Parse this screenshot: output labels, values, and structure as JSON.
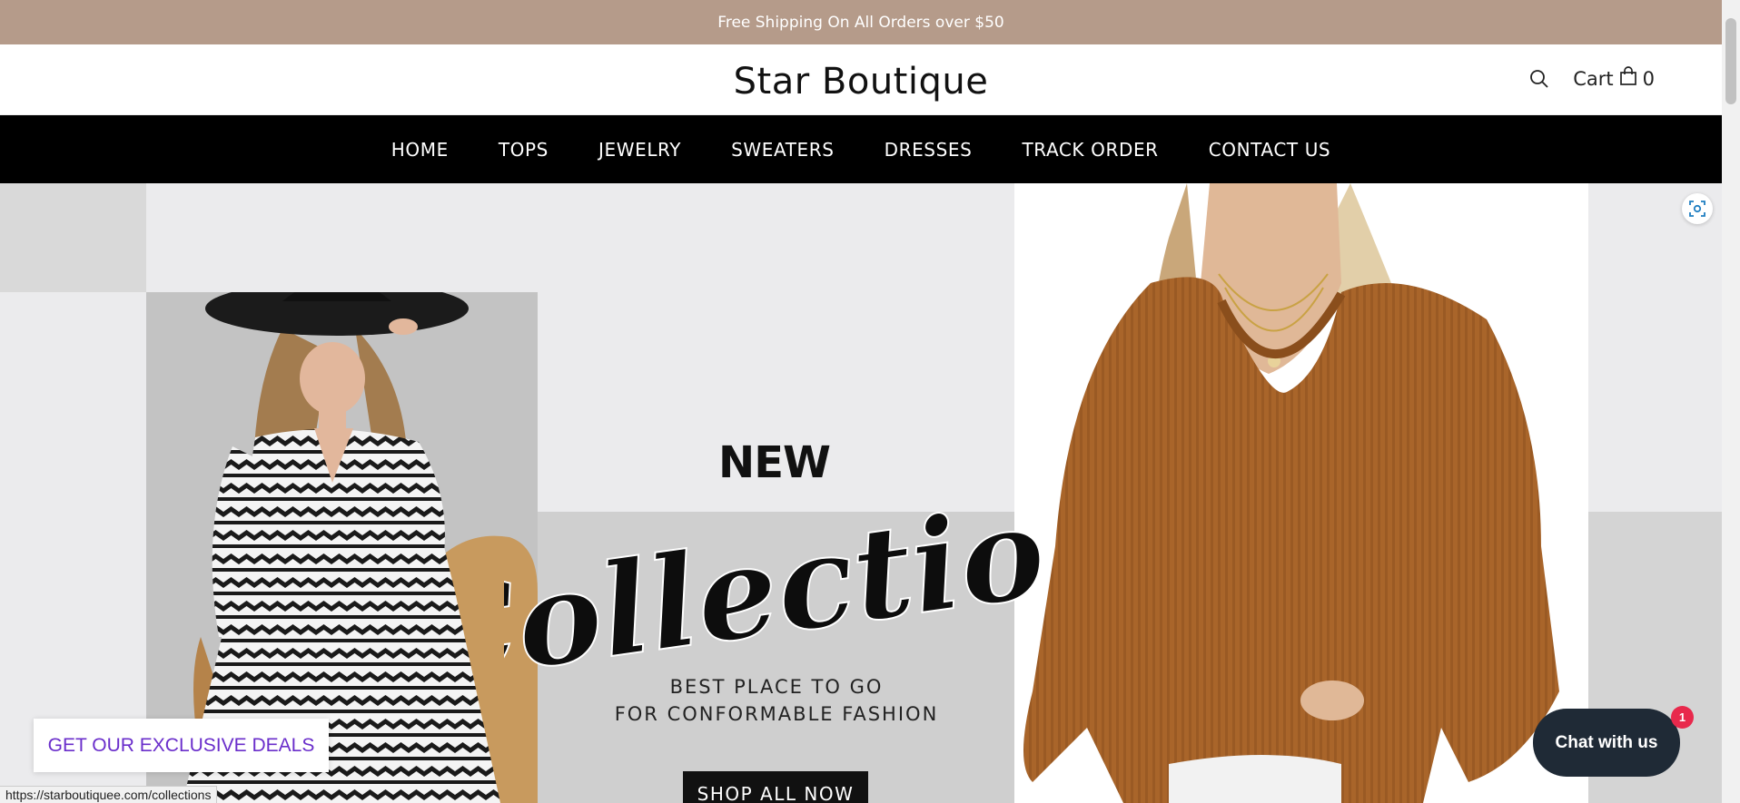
{
  "announcement": {
    "text": "Free Shipping On All Orders over $50"
  },
  "header": {
    "logo": "Star Boutique",
    "cart_label": "Cart",
    "cart_count": "0"
  },
  "nav": {
    "items": [
      "HOME",
      "TOPS",
      "JEWELRY",
      "SWEATERS",
      "DRESSES",
      "TRACK ORDER",
      "CONTACT US"
    ]
  },
  "hero": {
    "headline_top": "NEW",
    "headline_script": "Collection",
    "tagline_line1": "BEST PLACE TO GO",
    "tagline_line2": "FOR CONFORMABLE FASHION",
    "cta_label": "SHOP ALL NOW"
  },
  "popup": {
    "deals_label": "GET OUR EXCLUSIVE DEALS"
  },
  "chat": {
    "label": "Chat with us",
    "badge_count": "1"
  },
  "status_bar": {
    "url": "https://starboutiquee.com/collections"
  },
  "icons": {
    "search": "search-icon",
    "cart": "shopping-bag-icon",
    "scan": "visual-search-icon"
  },
  "colors": {
    "announcement_bg": "#b59b8a",
    "nav_bg": "#000000",
    "deals_text": "#6a2ecb",
    "chat_bg": "#1f2a36",
    "badge_bg": "#e8294c"
  }
}
